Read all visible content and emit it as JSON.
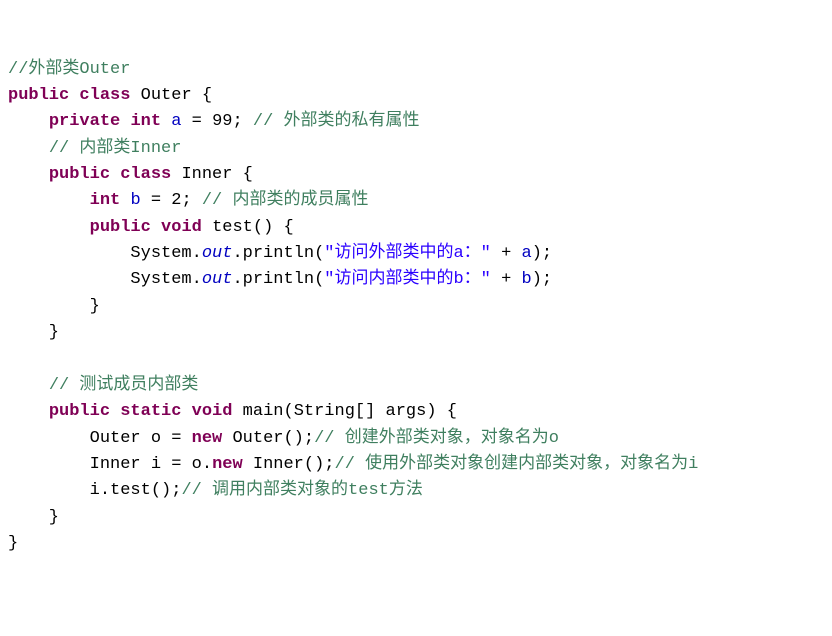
{
  "code": {
    "c1": "//外部类Outer",
    "kw_public": "public",
    "kw_class": "class",
    "kw_private": "private",
    "kw_int": "int",
    "kw_void": "void",
    "kw_static": "static",
    "kw_new": "new",
    "cls_outer": "Outer",
    "cls_inner": "Inner",
    "field_a": "a",
    "val_99": "99",
    "c2": "// 外部类的私有属性",
    "c3": "// 内部类Inner",
    "field_b": "b",
    "val_2": "2",
    "c4": "// 内部类的成员属性",
    "fn_test": "test",
    "sys": "System",
    "out": "out",
    "println": "println",
    "str1": "\"访问外部类中的a：\"",
    "str2": "\"访问内部类中的b：\"",
    "c5": "// 测试成员内部类",
    "fn_main": "main",
    "main_arg": "String[] args",
    "var_o": "o",
    "var_i": "i",
    "c6": "// 创建外部类对象，对象名为o",
    "c7": "// 使用外部类对象创建内部类对象，对象名为i",
    "c8": "// 调用内部类对象的test方法"
  }
}
